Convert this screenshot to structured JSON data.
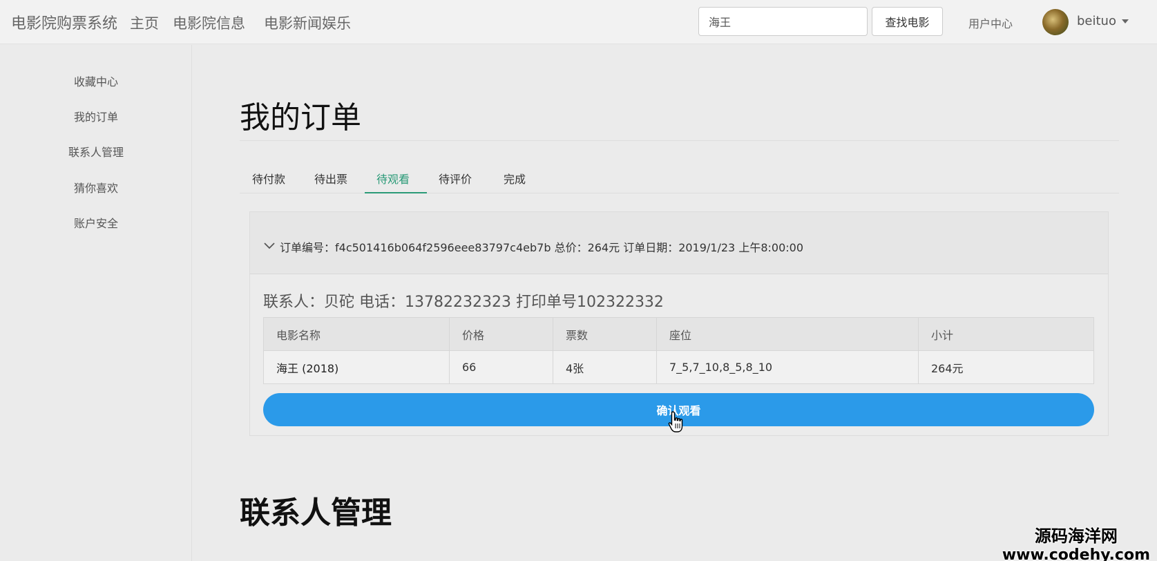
{
  "navbar": {
    "brand": "电影院购票系统",
    "links": [
      "主页",
      "电影院信息",
      "电影新闻娱乐"
    ],
    "search_value": "海王",
    "search_button": "查找电影",
    "user_center": "用户中心",
    "username": "beituo"
  },
  "sidebar": {
    "items": [
      "收藏中心",
      "我的订单",
      "联系人管理",
      "猜你喜欢",
      "账户安全"
    ]
  },
  "main": {
    "title": "我的订单",
    "tabs": [
      "待付款",
      "待出票",
      "待观看",
      "待评价",
      "完成"
    ],
    "active_tab": "待观看",
    "order": {
      "summary": "订单编号：f4c501416b064f2596eee83797c4eb7b  总价：264元 订单日期：2019/1/23 上午8:00:00",
      "contact_line": "联系人：贝砣 电话：13782232323 打印单号102322332",
      "columns": [
        "电影名称",
        "价格",
        "票数",
        "座位",
        "小计"
      ],
      "rows": [
        [
          "海王 (2018)",
          "66",
          "4张",
          "7_5,7_10,8_5,8_10",
          "264元"
        ]
      ],
      "confirm_button": "确认观看"
    },
    "section_title": "联系人管理"
  },
  "watermark": {
    "line1": "源码海洋网",
    "line2": "www.codehy.com"
  },
  "colors": {
    "accent_green": "#2a9a77",
    "button_blue": "#2b9ae9"
  }
}
